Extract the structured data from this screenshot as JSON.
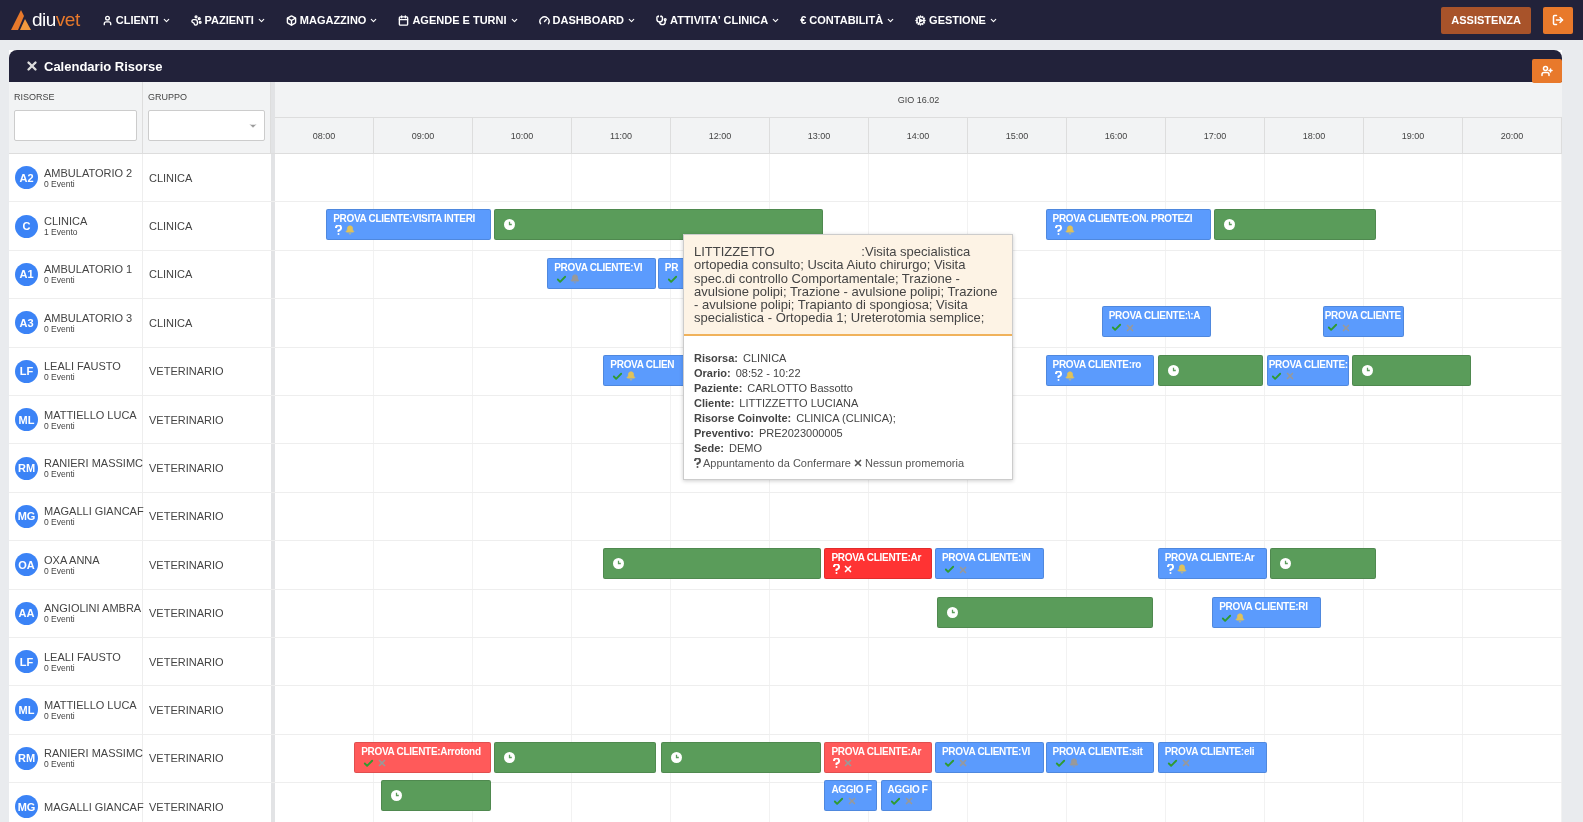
{
  "logo": {
    "text": "diu",
    "accent": "vet"
  },
  "nav": [
    {
      "label": "CLIENTI"
    },
    {
      "label": "PAZIENTI"
    },
    {
      "label": "MAGAZZINO"
    },
    {
      "label": "AGENDE E TURNI"
    },
    {
      "label": "DASHBOARD"
    },
    {
      "label": "ATTIVITA' CLINICA"
    },
    {
      "label": "€ CONTABILITÀ"
    },
    {
      "label": "GESTIONE"
    }
  ],
  "assist_button": "ASSISTENZA",
  "panel": {
    "title": "Calendario Risorse"
  },
  "columns": {
    "resources": "RISORSE",
    "group": "GRUPPO",
    "date": "GIO 16.02"
  },
  "hours": [
    "08:00",
    "09:00",
    "10:00",
    "11:00",
    "12:00",
    "13:00",
    "14:00",
    "15:00",
    "16:00",
    "17:00",
    "18:00",
    "19:00",
    "20:00"
  ],
  "resources": [
    {
      "initials": "A2",
      "name": "AMBULATORIO 2",
      "count": "0 Eventi",
      "group": "CLINICA"
    },
    {
      "initials": "C",
      "name": "CLINICA",
      "count": "1 Evento",
      "group": "CLINICA",
      "lanes": [
        [
          {
            "kind": "appointment",
            "color": "#5b9bfd",
            "title": "PROVA CLIENTE:VISITA INTERI",
            "confirmed": false,
            "reminder": true,
            "muted": false
          },
          {
            "kind": "block",
            "color": "#5a9c5a"
          },
          {
            "kind": "appointment",
            "color": "#5b9bfd",
            "title": "PROVA CLIENTE:ON. PROTEZI",
            "confirmed": false,
            "reminder": true,
            "muted": false
          },
          {
            "kind": "block",
            "color": "#5a9c5a"
          }
        ]
      ]
    },
    {
      "initials": "A1",
      "name": "AMBULATORIO 1",
      "count": "0 Eventi",
      "group": "CLINICA",
      "lanes": [
        [
          {
            "kind": "appointment",
            "color": "#5b9bfd",
            "title": "PROVA CLIENTE:VI",
            "confirmed": true,
            "reminder": true,
            "muted": true
          },
          {
            "kind": "appointment",
            "color": "#5b9bfd",
            "title": "PR",
            "confirmed": true
          }
        ]
      ]
    },
    {
      "initials": "A3",
      "name": "AMBULATORIO 3",
      "count": "0 Eventi",
      "group": "CLINICA",
      "lanes": [
        [
          {
            "kind": "appointment",
            "color": "#5b9bfd",
            "title": "PROVA CLIENTE:\\:A",
            "confirmed": true,
            "reminder": false,
            "muted": true
          },
          {
            "kind": "appointment",
            "color": "#5b9bfd",
            "title": "PROVA CLIENTE",
            "confirmed": true,
            "reminder": false,
            "muted": true
          }
        ]
      ]
    },
    {
      "initials": "LF",
      "name": "LEALI FAUSTO",
      "count": "0 Eventi",
      "group": "VETERINARIO",
      "lanes": [
        [
          {
            "kind": "appointment",
            "color": "#5b9bfd",
            "title": "PROVA CLIEN",
            "confirmed": true,
            "reminder": true,
            "muted": false
          },
          {
            "kind": "appointment",
            "color": "#5b9bfd",
            "title": "PROVA CLIENTE:ro",
            "confirmed": false,
            "reminder": true,
            "muted": false
          },
          {
            "kind": "block",
            "color": "#5a9c5a"
          },
          {
            "kind": "appointment",
            "color": "#5b9bfd",
            "title": "PROVA CLIENTE:",
            "confirmed": true,
            "reminder": false,
            "muted": true
          },
          {
            "kind": "block",
            "color": "#5a9c5a"
          }
        ]
      ]
    },
    {
      "initials": "ML",
      "name": "MATTIELLO LUCA",
      "count": "0 Eventi",
      "group": "VETERINARIO"
    },
    {
      "initials": "RM",
      "name": "RANIERI MASSIMC",
      "count": "0 Eventi",
      "group": "VETERINARIO"
    },
    {
      "initials": "MG",
      "name": "MAGALLI GIANCAF",
      "count": "0 Eventi",
      "group": "VETERINARIO"
    },
    {
      "initials": "OA",
      "name": "OXA ANNA",
      "count": "0 Eventi",
      "group": "VETERINARIO",
      "lanes": [
        [
          {
            "kind": "block",
            "color": "#5a9c5a"
          },
          {
            "kind": "appointment",
            "color": "#ff3333",
            "title": "PROVA CLIENTE:Ar",
            "confirmed": false,
            "reminder": false,
            "muted": false
          },
          {
            "kind": "appointment",
            "color": "#5b9bfd",
            "title": "PROVA CLIENTE:\\N",
            "confirmed": true,
            "reminder": false,
            "muted": true
          },
          {
            "kind": "appointment",
            "color": "#5b9bfd",
            "title": "PROVA CLIENTE:Ar",
            "confirmed": false,
            "reminder": true,
            "muted": false
          },
          {
            "kind": "block",
            "color": "#5a9c5a"
          }
        ]
      ]
    },
    {
      "initials": "AA",
      "name": "ANGIOLINI AMBRA",
      "count": "0 Eventi",
      "group": "VETERINARIO",
      "lanes": [
        [
          {
            "kind": "block",
            "color": "#5a9c5a"
          },
          {
            "kind": "appointment",
            "color": "#5b9bfd",
            "title": "PROVA CLIENTE:RI",
            "confirmed": true,
            "reminder": true,
            "muted": false
          }
        ]
      ]
    },
    {
      "initials": "LF",
      "name": "LEALI FAUSTO",
      "count": "0 Eventi",
      "group": "VETERINARIO"
    },
    {
      "initials": "ML",
      "name": "MATTIELLO LUCA",
      "count": "0 Eventi",
      "group": "VETERINARIO"
    },
    {
      "initials": "RM",
      "name": "RANIERI MASSIMC",
      "count": "0 Eventi",
      "group": "VETERINARIO",
      "lanes": [
        [
          {
            "kind": "appointment",
            "color": "#ff5a5a",
            "title": "PROVA CLIENTE:Arrotond",
            "confirmed": true,
            "reminder": false,
            "muted": true
          },
          {
            "kind": "block",
            "color": "#5a9c5a"
          },
          {
            "kind": "block",
            "color": "#5a9c5a"
          },
          {
            "kind": "appointment",
            "color": "#ff5a5a",
            "title": "PROVA CLIENTE:Ar",
            "confirmed": false,
            "reminder": false,
            "muted": true
          },
          {
            "kind": "appointment",
            "color": "#5b9bfd",
            "title": "PROVA CLIENTE:VI",
            "confirmed": true,
            "reminder": false,
            "muted": true
          },
          {
            "kind": "appointment",
            "color": "#5b9bfd",
            "title": "PROVA CLIENTE:sit",
            "confirmed": true,
            "reminder": true,
            "muted": true
          },
          {
            "kind": "appointment",
            "color": "#5b9bfd",
            "title": "PROVA CLIENTE:eli",
            "confirmed": true,
            "reminder": false,
            "muted": true
          }
        ],
        [
          {
            "kind": "block",
            "color": "#5a9c5a"
          },
          {
            "kind": "appointment",
            "color": "#5b9bfd",
            "title": "AGGIO F",
            "confirmed": true,
            "reminder": false,
            "muted": true
          },
          {
            "kind": "appointment",
            "color": "#5b9bfd",
            "title": "AGGIO F",
            "confirmed": true,
            "reminder": false,
            "muted": true
          }
        ]
      ]
    },
    {
      "initials": "MG",
      "name": "MAGALLI GIANCAF",
      "group": "VETERINARIO"
    }
  ],
  "tooltip": {
    "title": "LITTIZZETTO                        :Visita specialistica ortopedia consulto; Uscita Aiuto chirurgo; Visita spec.di controllo Comportamentale; Trazione - avulsione polipi; Trazione - avulsione polipi; Trazione - avulsione polipi; Trapianto di spongiosa; Visita specialistica - Ortopedia 1; Ureterotomia semplice;",
    "fields": [
      {
        "label": "Risorsa:",
        "value": "CLINICA"
      },
      {
        "label": "Orario:",
        "value": "08:52 - 10:22"
      },
      {
        "label": "Paziente:",
        "value": "CARLOTTO Bassotto"
      },
      {
        "label": "Cliente:",
        "value": "LITTIZZETTO LUCIANA"
      },
      {
        "label": "Risorse Coinvolte:",
        "value": "CLINICA (CLINICA);"
      },
      {
        "label": "Preventivo:",
        "value": "PRE2023000005"
      },
      {
        "label": "Sede:",
        "value": "DEMO"
      }
    ],
    "status": "Appuntamento da Confermare",
    "reminder": "Nessun promemoria"
  }
}
